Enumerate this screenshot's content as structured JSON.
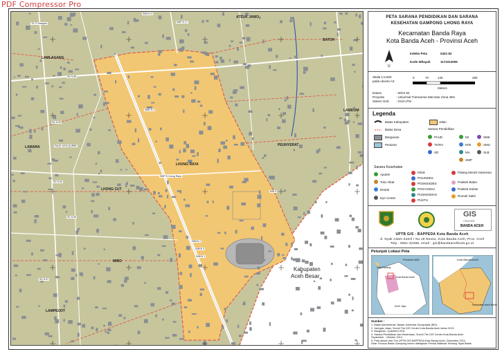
{
  "watermark": "PDF Compressor Pro",
  "title": {
    "line1": "PETA SARANA PENDIDIKAN DAN SARANA",
    "line2": "KESEHATAN GAMPONG LHONG RAYA",
    "line3": "Kecamatan Banda Raya",
    "line4": "Kota Banda Aceh - Provinsi Aceh"
  },
  "index": {
    "index_label": "Indeks Peta",
    "index_value": "0421-52",
    "kode_label": "Kode Wilayah",
    "kode_value": "1171012005",
    "north": "U"
  },
  "scale": {
    "skala": "Skala 1:6.500",
    "kertas": "pada ukuran A3",
    "ticks": [
      "0",
      "70",
      "140",
      "280"
    ],
    "unit": "Meters"
  },
  "projection": {
    "datum_label": "Datum",
    "datum_value": ": WGS 84",
    "proyeksi_label": "Proyeksi",
    "proyeksi_value": ": Universal Transverse Mercator Zona 46N",
    "grid_label": "Sistem Grid",
    "grid_value": ": Grid UTM"
  },
  "legend": {
    "title": "Legenda",
    "items": {
      "batas_kabupaten": "Batas Kabupaten",
      "jalan": "Jalan",
      "batas_desa": "Batas Desa",
      "sarana_pendidikan": "Sarana Pendidikan",
      "bangunan": "Bangunan",
      "paud": "PAUD",
      "mi": "MI",
      "smk": "SMK",
      "perairan": "Perairan",
      "tk_ra": "TK/RA",
      "mts": "MTs",
      "smu": "SMU",
      "sd": "SD",
      "ma": "MA",
      "slb": "SLB",
      "smp": "SMP"
    },
    "kesehatan_title": "Sarana Kesehatan",
    "kesehatan": {
      "apotek": "Apotek",
      "klinik": "Klinik",
      "palang_merah": "Palang Merah Indonesia",
      "toko_obat": "Toko Obat",
      "polindes": "POLINDES",
      "poskesdes": "POSKESDES",
      "praktek_bidan": "Praktek Bidan",
      "posyandu": "POSYANDU",
      "praktek_dokter": "Praktek Dokter",
      "dental": "Dental",
      "puskesmas": "PUSKESMAS",
      "rumah_sakit": "Rumah Sakit",
      "eye_center": "Eye Center",
      "pustu": "PUSTU"
    }
  },
  "institution": {
    "gis": "GIS",
    "center": "CENTER",
    "banda": "BANDA ACEH",
    "line1": "UPTB GIS - BAPPEDA Kota Banda Aceh",
    "line2": "Jl. Nyak Adam Kamil I No.19 Neusu, Kota Banda Aceh, Prov. Aceh",
    "line3": "Telp : 0651-32398, email : gis@bandaacehkota.go.id"
  },
  "location": {
    "title": "Petunjuk Lokasi Peta",
    "provinsi": "Provinsi NAD",
    "kota": "Kota Banda Aceh",
    "kota_label": "Kota Banda Aceh",
    "kab_sabang": "Kota Sabang",
    "aceh_jaya": "Aceh Jaya",
    "kab_aceh_besar": "Kabupaten Aceh Besar"
  },
  "notes": {
    "title": "Sumber :",
    "lines": [
      "1. Batas Administrasi, Badan Informasi Geospasial (BIG)",
      "2. Jaringan Jalan, Survei Tim GIS Center Kota Banda Aceh tahun 2013",
      "3. Bangunan, Quickbird 2011",
      "4. Sarana Pendidikan dan Kesehatan, Survei Tim GIS Center Kota Banda Aceh",
      "   September - Oktober 2014",
      "5. Peta dibuat oleh Tim UPTB GIS BAPPEDA Kota Banda Aceh, Desember 2014",
      "   Note: Khusus Batas Gampong belum ditetapkan Perwal Walikota Tentang Tapal Batas."
    ]
  },
  "map": {
    "villages": [
      "ATEUK JAWO",
      "BATOH",
      "LAMLAGANG",
      "LAMDOM",
      "PEUNYERAT",
      "LAMARA",
      "LHONG RAYA",
      "LHONG CUT",
      "MIBO",
      "LAMPEUOT"
    ],
    "kabupaten": [
      "Kabupaten",
      "Aceh Besar"
    ],
    "schools": [
      "SMA N 4",
      "SMP N 17",
      "TK IT Harapan",
      "PAUD JAYA QURBE",
      "SMK N 3",
      "SMKN 2",
      "SMKN 3",
      "SMKN 1",
      "SMP N Lhong Raya",
      "SD N 63",
      "SD N 62",
      "SD N 65",
      "MIN 9",
      "SD N 59",
      "SD N 67"
    ],
    "colors": {
      "village_fill": "#f2c773",
      "outside": "#c7c59c",
      "water": "#9dc4d8",
      "building": "#8a8f94",
      "road": "#ffffff",
      "boundary": "#e04b3a"
    }
  }
}
